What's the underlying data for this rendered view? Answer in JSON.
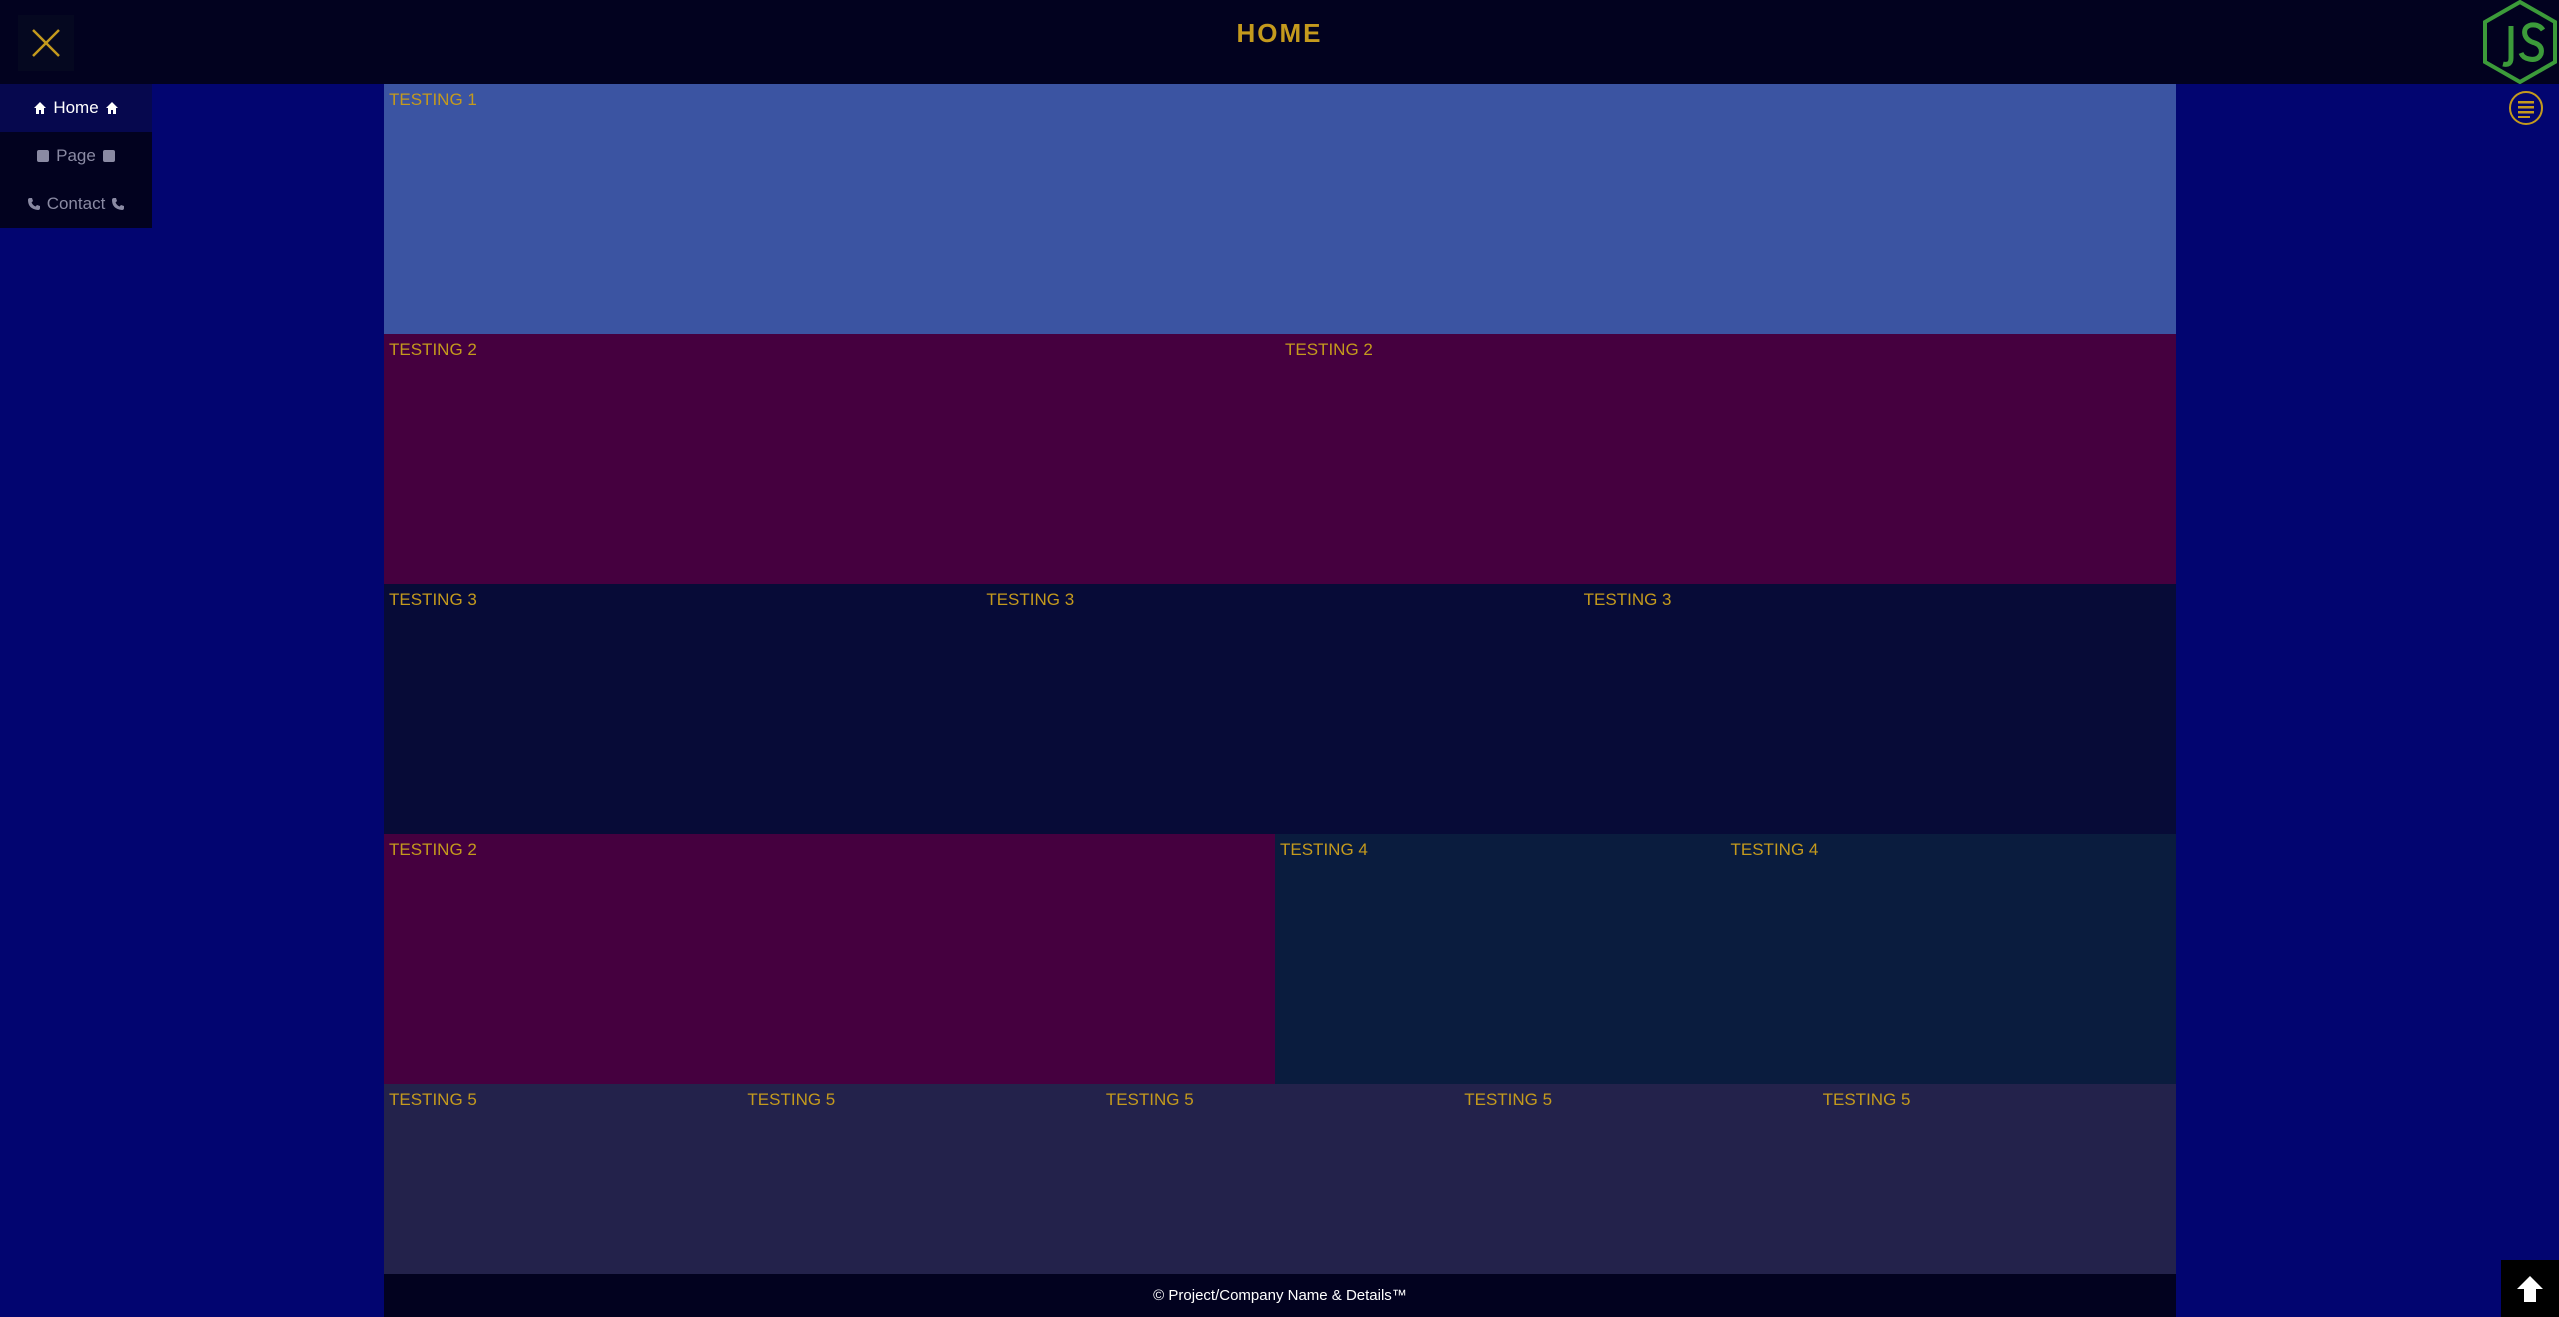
{
  "header": {
    "title": "HOME",
    "menu_toggle_icon": "close-icon",
    "logo_icon": "nodejs-icon",
    "list_toggle_icon": "list-icon"
  },
  "sidenav": {
    "items": [
      {
        "label": "Home",
        "icon": "home-icon",
        "active": true
      },
      {
        "label": "Page",
        "icon": "square-icon",
        "active": false
      },
      {
        "label": "Contact",
        "icon": "phone-icon",
        "active": false
      }
    ]
  },
  "grid": {
    "row1": [
      "TESTING 1"
    ],
    "row2": [
      "TESTING 2",
      "TESTING 2"
    ],
    "row3": [
      "TESTING 3",
      "TESTING 3",
      "TESTING 3"
    ],
    "row4": [
      "TESTING 2",
      "TESTING 4",
      "TESTING 4"
    ],
    "row5": [
      "TESTING 5",
      "TESTING 5",
      "TESTING 5",
      "TESTING 5",
      "TESTING 5"
    ]
  },
  "footer": {
    "text": "© Project/Company Name & Details™"
  },
  "scroll_top_icon": "arrow-up-icon",
  "colors": {
    "accent": "#c49a1d",
    "background": "#020570",
    "header": "#02021f",
    "row1": "#3b54a2",
    "row2": "#45003f",
    "row3": "#070b37",
    "row4": "#0a1c3e",
    "row5": "#23224b"
  }
}
